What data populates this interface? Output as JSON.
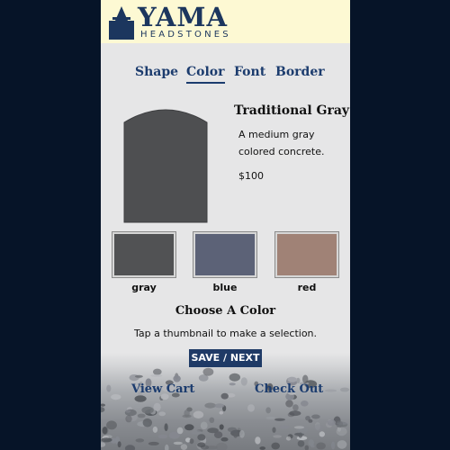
{
  "brand": {
    "name": "YAMA",
    "tagline": "HEADSTONES",
    "color": "#1c365e"
  },
  "tabs": [
    {
      "label": "Shape",
      "active": false
    },
    {
      "label": "Color",
      "active": true
    },
    {
      "label": "Font",
      "active": false
    },
    {
      "label": "Border",
      "active": false
    }
  ],
  "selection": {
    "title": "Traditional Gray",
    "description": "A medium gray colored concrete.",
    "price": "$100",
    "color": "#4e4f51"
  },
  "swatches": [
    {
      "label": "gray",
      "color": "#515254"
    },
    {
      "label": "blue",
      "color": "#5c6277"
    },
    {
      "label": "red",
      "color": "#a08276"
    }
  ],
  "chooser": {
    "title": "Choose A Color",
    "hint": "Tap a thumbnail to make a selection."
  },
  "actions": {
    "save_label": "SAVE / NEXT",
    "view_cart_label": "View Cart",
    "checkout_label": "Check Out"
  },
  "colors": {
    "accent": "#1c3c6e",
    "button": "#1f3a66",
    "header_bg": "#fdf9d3",
    "page_bg": "#061428"
  }
}
